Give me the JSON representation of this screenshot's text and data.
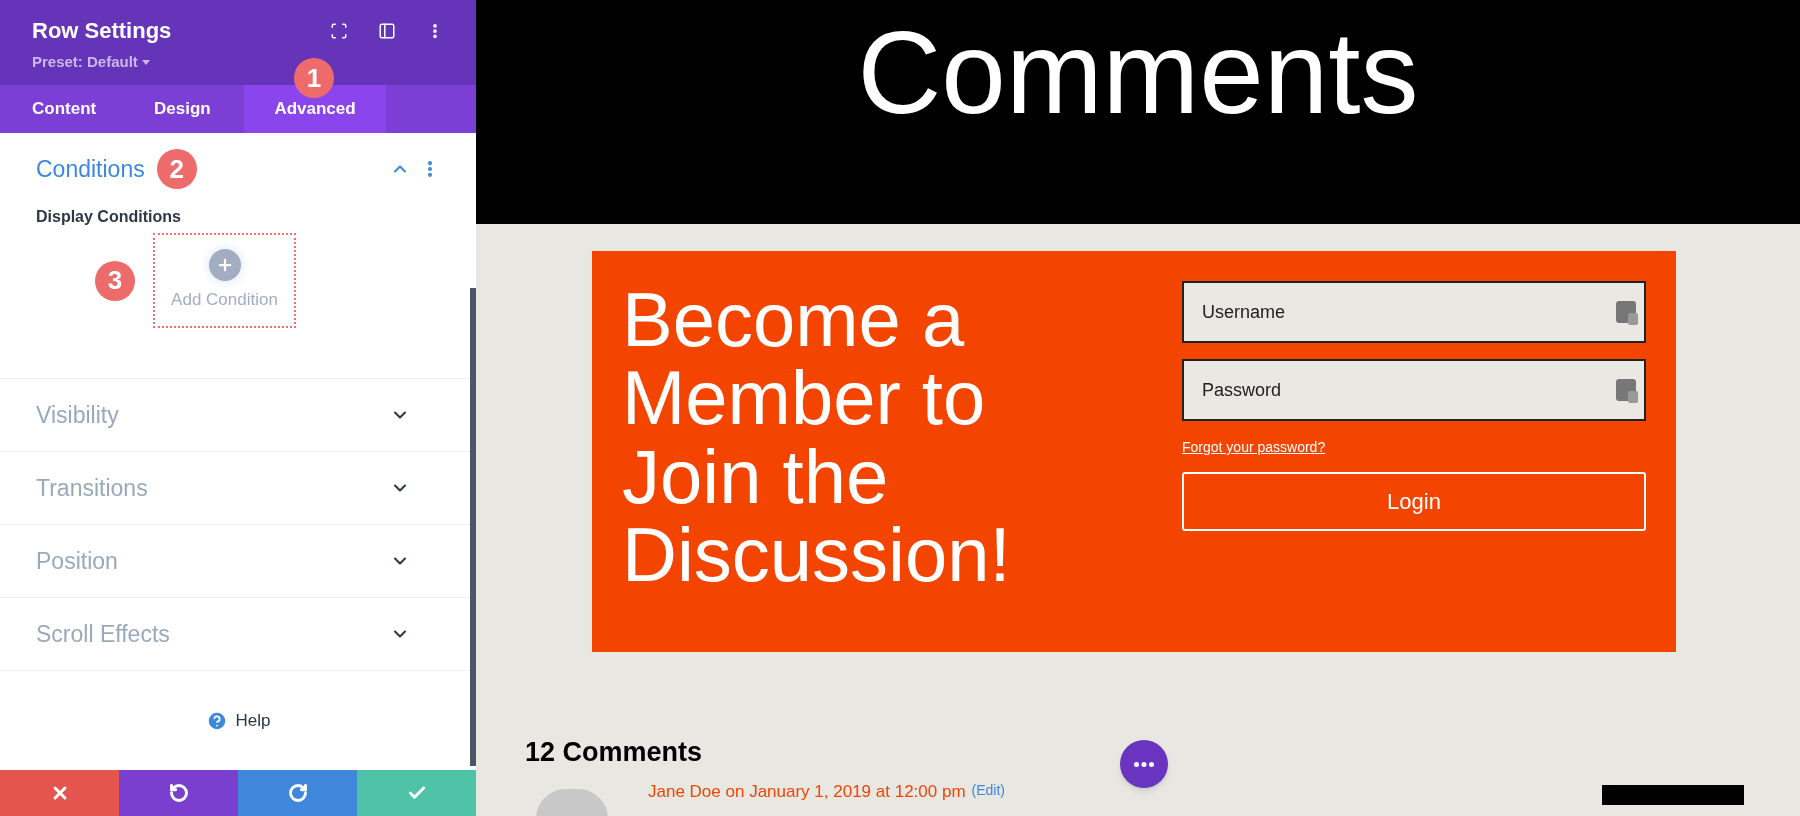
{
  "panel": {
    "title": "Row Settings",
    "preset": "Preset: Default",
    "tabs": [
      {
        "label": "Content",
        "selected": false
      },
      {
        "label": "Design",
        "selected": false
      },
      {
        "label": "Advanced",
        "selected": true
      }
    ],
    "sections": [
      {
        "title": "Conditions",
        "expanded": true,
        "field_label": "Display Conditions",
        "add_label": "Add Condition"
      },
      {
        "title": "Visibility",
        "expanded": false
      },
      {
        "title": "Transitions",
        "expanded": false
      },
      {
        "title": "Position",
        "expanded": false
      },
      {
        "title": "Scroll Effects",
        "expanded": false
      }
    ],
    "help": "Help",
    "actions": [
      {
        "kind": "discard",
        "color": "#e5554f"
      },
      {
        "kind": "undo",
        "color": "#7b3fd0"
      },
      {
        "kind": "redo",
        "color": "#3e87db"
      },
      {
        "kind": "save",
        "color": "#4fc3a8"
      }
    ]
  },
  "markers": [
    "1",
    "2",
    "3"
  ],
  "page": {
    "heading": "Comments",
    "headline": "Become a Member to Join the Discussion!",
    "fields": [
      {
        "placeholder": "Username"
      },
      {
        "placeholder": "Password"
      }
    ],
    "forgot": "Forgot your password?",
    "login": "Login",
    "comment_count": "12 Comments",
    "comment_meta": "Jane Doe on January 1, 2019 at 12:00 pm",
    "edit": "(Edit)"
  }
}
